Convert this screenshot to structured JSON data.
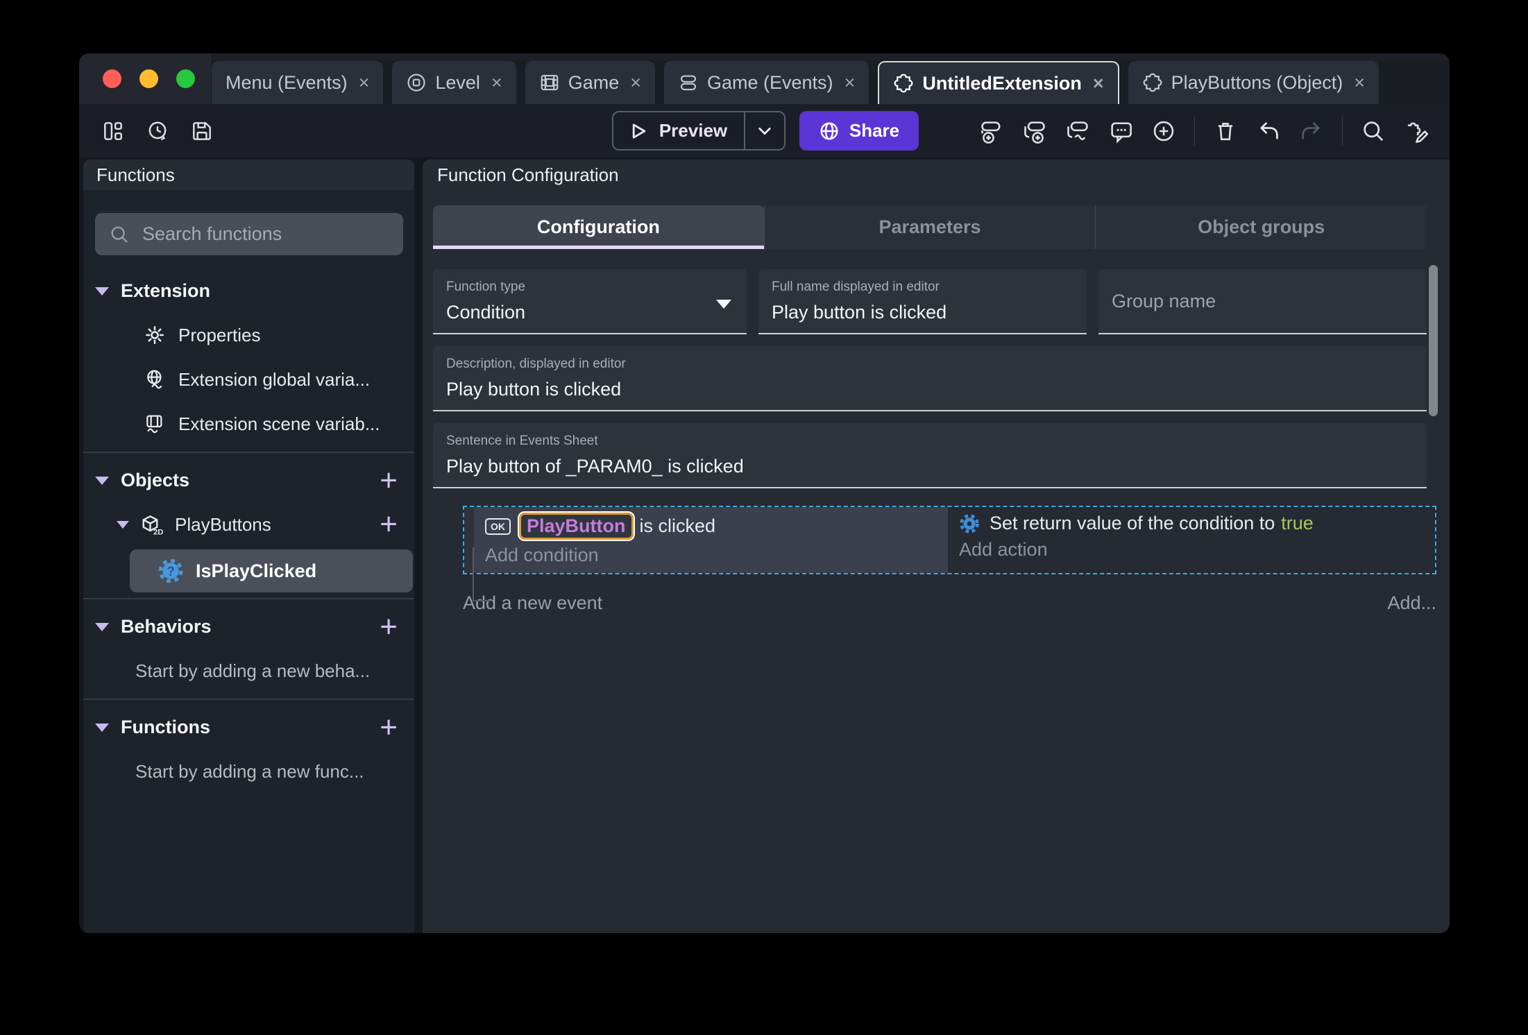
{
  "glyphs": {
    "close": "×",
    "plus": "+"
  },
  "titlebar": {
    "tabs": [
      {
        "label": "Menu (Events)"
      },
      {
        "label": "Level"
      },
      {
        "label": "Game"
      },
      {
        "label": "Game (Events)"
      },
      {
        "label": "UntitledExtension"
      },
      {
        "label": "PlayButtons (Object)"
      }
    ]
  },
  "toolbar": {
    "preview_label": "Preview",
    "share_label": "Share"
  },
  "sidebar": {
    "panel_title": "Functions",
    "search_placeholder": "Search functions",
    "sections": {
      "extension": {
        "label": "Extension",
        "items": [
          {
            "label": "Properties"
          },
          {
            "label": "Extension global varia..."
          },
          {
            "label": "Extension scene variab..."
          }
        ]
      },
      "objects": {
        "label": "Objects",
        "object": "PlayButtons",
        "selected_function": "IsPlayClicked"
      },
      "behaviors": {
        "label": "Behaviors",
        "empty_text": "Start by adding a new beha..."
      },
      "functions": {
        "label": "Functions",
        "empty_text": "Start by adding a new func..."
      }
    }
  },
  "main": {
    "panel_title": "Function Configuration",
    "tabs": [
      {
        "label": "Configuration"
      },
      {
        "label": "Parameters"
      },
      {
        "label": "Object groups"
      }
    ],
    "form": {
      "function_type_label": "Function type",
      "function_type_value": "Condition",
      "full_name_label": "Full name displayed in editor",
      "full_name_value": "Play button is clicked",
      "group_name_placeholder": "Group name",
      "description_label": "Description, displayed in editor",
      "description_value": "Play button is clicked",
      "sentence_label": "Sentence in Events Sheet",
      "sentence_value": "Play button of _PARAM0_ is clicked"
    },
    "events_sheet": {
      "condition_badge": "OK",
      "condition_object": "PlayButton",
      "condition_suffix": "is clicked",
      "add_condition_label": "Add condition",
      "action_text": "Set return value of the condition to",
      "action_value": "true",
      "add_action_label": "Add action",
      "add_event_label": "Add a new event",
      "add_more_label": "Add..."
    }
  },
  "colors": {
    "accent_purple": "#5b35d6",
    "selection_blue": "#41a8de",
    "object_purple": "#c77bdb",
    "chip_orange": "#e39b2d",
    "true_green": "#a4c659"
  }
}
